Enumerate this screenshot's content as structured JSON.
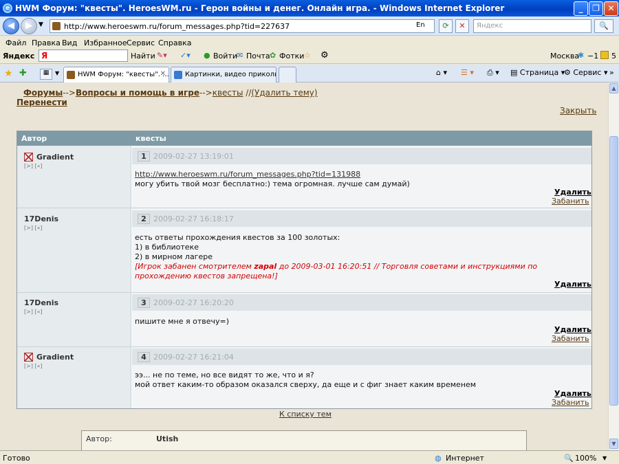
{
  "window": {
    "title": "HWM Форум: \"квесты\". HeroesWM.ru - Герон войны и денег. Онлайн игра. - Windows Internet Explorer"
  },
  "address": {
    "url": "http://www.heroeswm.ru/forum_messages.php?tid=227637",
    "lang": "En",
    "search_placeholder": "Яндекс"
  },
  "menu": [
    "Файл",
    "Правка",
    "Вид",
    "Избранное",
    "Сервис",
    "Справка"
  ],
  "yandexbar": {
    "logo_black": "Яндекс",
    "logo_red": "Я",
    "find": "Найти",
    "login": "Войти",
    "mail": "Почта",
    "photos": "Фотки",
    "city": "Москва",
    "temp": "−1",
    "count": "5"
  },
  "tabs": [
    {
      "label": "HWM Форум: \"квесты\". ..."
    },
    {
      "label": "Картинки, видео приколы,..."
    }
  ],
  "tools": {
    "page": "Страница",
    "service": "Сервис"
  },
  "page": {
    "breadcrumb": {
      "forums": "Форумы",
      "sep1": "-->",
      "section": "Вопросы и помощь в игре",
      "sep2": "-->",
      "topic": "квесты",
      "sep3": " //",
      "delete_topic": "(Удалить тему)"
    },
    "move": "Перенести",
    "close": "Закрыть",
    "table_header": {
      "author": "Автор",
      "topic": "квесты"
    },
    "mini_links": "[>] [«]",
    "posts": [
      {
        "num": "1",
        "date": "2009-02-27 13:19:01",
        "author": "Gradient",
        "lines": [
          "http://www.heroeswm.ru/forum_messages.php?tid=131988",
          "могу убить твой мозг бесплатно:) тема огромная. лучше сам думай)"
        ],
        "delete": "Удалить",
        "ban": "Забанить"
      },
      {
        "num": "2",
        "date": "2009-02-27 16:18:17",
        "author": "17Denis",
        "lines": [
          "есть ответы прохождения квестов за 100 золотых:",
          "1) в библиотеке",
          "2) в мирном лагере"
        ],
        "ban_notice": {
          "prefix": "[Игрок забанен смотрителем ",
          "moderator": "zapal",
          "suffix": " до 2009-03-01 16:20:51 // Торговля советами и инструкциями по",
          "line2": "прохождению квестов запрещена!]"
        },
        "delete": "Удалить"
      },
      {
        "num": "3",
        "date": "2009-02-27 16:20:20",
        "author": "17Denis",
        "lines": [
          "пишите мне я отвечу=)"
        ],
        "delete": "Удалить",
        "ban": "Забанить"
      },
      {
        "num": "4",
        "date": "2009-02-27 16:21:04",
        "author": "Gradient",
        "lines": [
          "ээ... не по теме, но все видят то же, что и я?",
          "мой ответ каким-то образом оказался сверху, да еще и с фиг знает каким временем"
        ],
        "delete": "Удалить",
        "ban": "Забанить"
      }
    ],
    "back_link": "К списку тем",
    "reply": {
      "author_label": "Автор:",
      "author_value": "Utish"
    }
  },
  "status": {
    "text": "Готово",
    "zone": "Интернет",
    "zoom": "100%"
  }
}
